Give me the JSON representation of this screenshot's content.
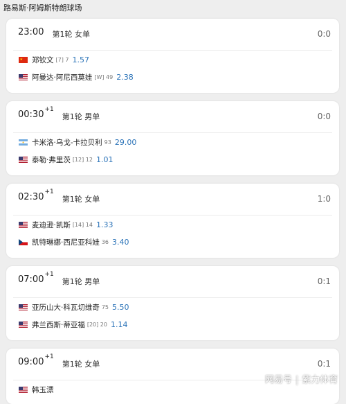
{
  "court": "路易斯·阿姆斯特朗球场",
  "matches": [
    {
      "time": "23:00",
      "day": "",
      "round": "第1轮 女单",
      "score": "0:0",
      "players": [
        {
          "flag": "cn",
          "name": "郑钦文",
          "seed": "[7] 7",
          "odds": "1.57"
        },
        {
          "flag": "us",
          "name": "阿曼达·阿尼西莫娃",
          "seed": "[W] 49",
          "odds": "2.38"
        }
      ]
    },
    {
      "time": "00:30",
      "day": "+1",
      "round": "第1轮 男单",
      "score": "0:0",
      "players": [
        {
          "flag": "ar",
          "name": "卡米洛·乌戈-卡拉贝利",
          "seed": "93",
          "odds": "29.00"
        },
        {
          "flag": "us",
          "name": "泰勒·弗里茨",
          "seed": "[12] 12",
          "odds": "1.01"
        }
      ]
    },
    {
      "time": "02:30",
      "day": "+1",
      "round": "第1轮 女单",
      "score": "1:0",
      "players": [
        {
          "flag": "us",
          "name": "麦迪逊·凯斯",
          "seed": "[14] 14",
          "odds": "1.33"
        },
        {
          "flag": "cz",
          "name": "凯特琳娜·西尼亚科娃",
          "seed": "36",
          "odds": "3.40"
        }
      ]
    },
    {
      "time": "07:00",
      "day": "+1",
      "round": "第1轮 男单",
      "score": "0:1",
      "players": [
        {
          "flag": "us",
          "name": "亚历山大·科瓦切维奇",
          "seed": "75",
          "odds": "5.50"
        },
        {
          "flag": "us",
          "name": "弗兰西斯·蒂亚福",
          "seed": "[20] 20",
          "odds": "1.14"
        }
      ]
    },
    {
      "time": "09:00",
      "day": "+1",
      "round": "第1轮 女单",
      "score": "0:1",
      "players": [
        {
          "flag": "us",
          "name": "韩玉漂",
          "seed": "",
          "odds": ""
        }
      ]
    }
  ],
  "watermark": {
    "source": "网易号",
    "author": "紫力体育"
  }
}
